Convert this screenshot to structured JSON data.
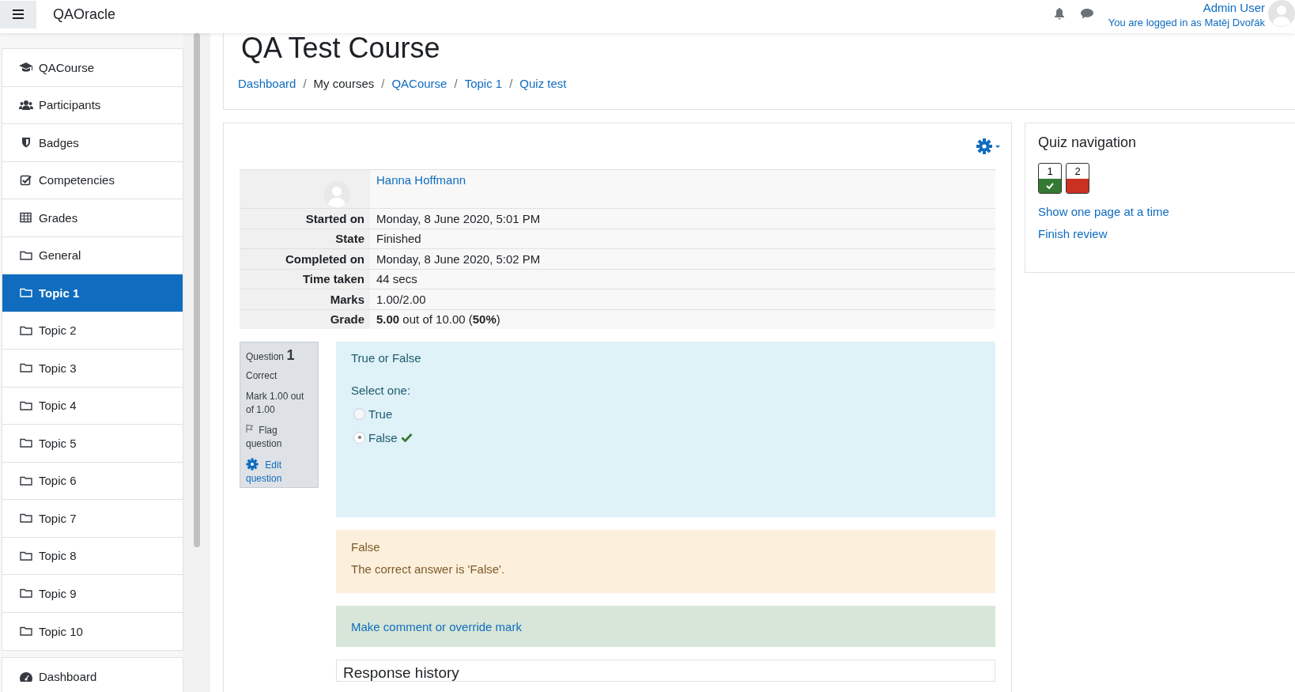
{
  "navbar": {
    "site_name": "QAOracle",
    "user_name": "Admin User",
    "logged_in_as": "You are logged in as Matěj Dvořák"
  },
  "sidebar": {
    "groups": [
      {
        "items": [
          {
            "kind": "course",
            "label": "QACourse",
            "selected": false
          },
          {
            "kind": "participants",
            "label": "Participants",
            "selected": false
          },
          {
            "kind": "badges",
            "label": "Badges",
            "selected": false
          },
          {
            "kind": "competencies",
            "label": "Competencies",
            "selected": false
          },
          {
            "kind": "grades",
            "label": "Grades",
            "selected": false
          },
          {
            "kind": "folder",
            "label": "General",
            "selected": false
          },
          {
            "kind": "folder",
            "label": "Topic 1",
            "selected": true
          },
          {
            "kind": "folder",
            "label": "Topic 2",
            "selected": false
          },
          {
            "kind": "folder",
            "label": "Topic 3",
            "selected": false
          },
          {
            "kind": "folder",
            "label": "Topic 4",
            "selected": false
          },
          {
            "kind": "folder",
            "label": "Topic 5",
            "selected": false
          },
          {
            "kind": "folder",
            "label": "Topic 6",
            "selected": false
          },
          {
            "kind": "folder",
            "label": "Topic 7",
            "selected": false
          },
          {
            "kind": "folder",
            "label": "Topic 8",
            "selected": false
          },
          {
            "kind": "folder",
            "label": "Topic 9",
            "selected": false
          },
          {
            "kind": "folder",
            "label": "Topic 10",
            "selected": false
          }
        ]
      },
      {
        "items": [
          {
            "kind": "dashboard",
            "label": "Dashboard",
            "selected": false
          }
        ]
      }
    ]
  },
  "header": {
    "title": "QA Test Course",
    "breadcrumb": [
      {
        "label": "Dashboard",
        "link": true
      },
      {
        "separator": "/",
        "label": "My courses",
        "link": false
      },
      {
        "separator": "/",
        "label": "QACourse",
        "link": true
      },
      {
        "separator": "/",
        "label": "Topic 1",
        "link": true
      },
      {
        "separator": "/",
        "label": "Quiz test",
        "link": true
      }
    ]
  },
  "summary": {
    "user": "Hanna Hoffmann",
    "rows": [
      {
        "label": "Started on",
        "value": "Monday, 8 June 2020, 5:01 PM"
      },
      {
        "label": "State",
        "value": "Finished"
      },
      {
        "label": "Completed on",
        "value": "Monday, 8 June 2020, 5:02 PM"
      },
      {
        "label": "Time taken",
        "value": "44 secs"
      },
      {
        "label": "Marks",
        "value": "1.00/2.00"
      },
      {
        "label": "Grade",
        "value": "**5.00** out of 10.00 (**50%**)"
      }
    ]
  },
  "question": {
    "label": "Question",
    "number": "1",
    "status": "Correct",
    "mark": "Mark 1.00 out of 1.00",
    "flag": "Flag question",
    "edit": "Edit question",
    "text": "True or False",
    "prompt": "Select one:",
    "options": [
      {
        "label": "True",
        "selected": false,
        "marked_correct": false
      },
      {
        "label": "False",
        "selected": true,
        "marked_correct": true
      }
    ],
    "feedback_title": "False",
    "feedback": "The correct answer is 'False'.",
    "comment_link": "Make comment or override mark",
    "history_title": "Response history"
  },
  "quiz_navigation": {
    "title": "Quiz navigation",
    "buttons": [
      {
        "number": "1",
        "kind": "correct",
        "color": "#357a32"
      },
      {
        "number": "2",
        "kind": "incorrect",
        "color": "#ca3120"
      }
    ],
    "links": [
      "Show one page at a time",
      "Finish review"
    ]
  }
}
